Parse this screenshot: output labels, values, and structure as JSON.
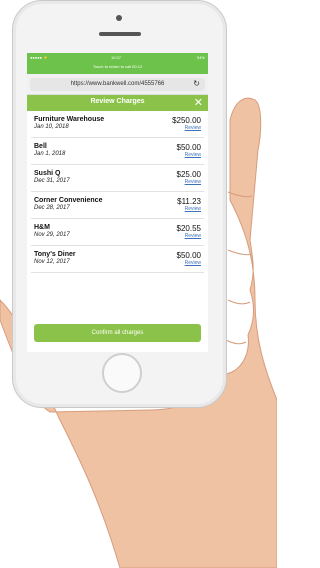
{
  "status_bar": {
    "signal": "●●●●● ⚡",
    "time": "10:37",
    "battery": "54%",
    "return_text": "Touch to return to call 00:12"
  },
  "browser": {
    "url": "https://www.bankwell.com/4555766"
  },
  "header": {
    "title": "Review Charges",
    "close_glyph": "✕"
  },
  "charges": [
    {
      "merchant": "Furniture Warehouse",
      "date": "Jan 10, 2018",
      "amount": "$250.00",
      "action": "Review"
    },
    {
      "merchant": "Bell",
      "date": "Jan 1, 2018",
      "amount": "$50.00",
      "action": "Review"
    },
    {
      "merchant": "Sushi Q",
      "date": "Dec 31, 2017",
      "amount": "$25.00",
      "action": "Review"
    },
    {
      "merchant": "Corner Convenience",
      "date": "Dec 28, 2017",
      "amount": "$11.23",
      "action": "Review"
    },
    {
      "merchant": "H&M",
      "date": "Nov 29, 2017",
      "amount": "$20.55",
      "action": "Review"
    },
    {
      "merchant": "Tony's Diner",
      "date": "Nov 12, 2017",
      "amount": "$50.00",
      "action": "Review"
    }
  ],
  "footer": {
    "confirm_label": "Confirm all charges"
  },
  "colors": {
    "status_green": "#6cc24a",
    "accent_green": "#8bc34a",
    "link_blue": "#3a72b8"
  }
}
